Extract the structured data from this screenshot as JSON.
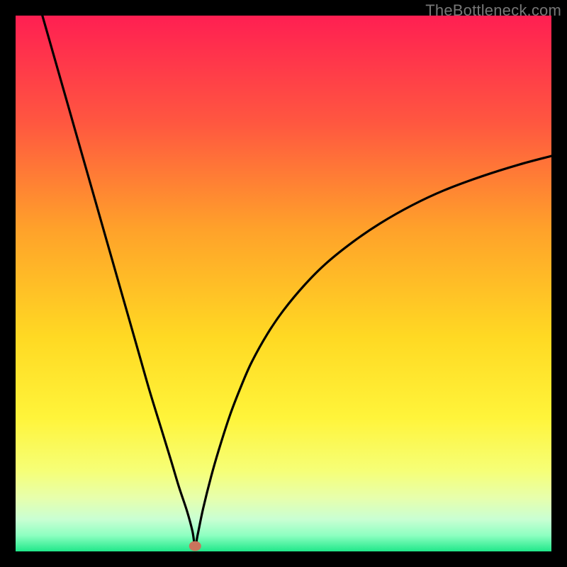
{
  "watermark": "TheBottleneck.com",
  "chart_data": {
    "type": "line",
    "title": "",
    "xlabel": "",
    "ylabel": "",
    "xlim": [
      0,
      100
    ],
    "ylim": [
      0,
      100
    ],
    "grid": false,
    "legend": false,
    "gradient_stops": [
      {
        "offset": 0.0,
        "color": "#ff1f52"
      },
      {
        "offset": 0.2,
        "color": "#ff5740"
      },
      {
        "offset": 0.4,
        "color": "#ffa22a"
      },
      {
        "offset": 0.6,
        "color": "#ffd923"
      },
      {
        "offset": 0.75,
        "color": "#fff43a"
      },
      {
        "offset": 0.85,
        "color": "#f6ff77"
      },
      {
        "offset": 0.9,
        "color": "#e7ffac"
      },
      {
        "offset": 0.94,
        "color": "#c9ffd3"
      },
      {
        "offset": 0.97,
        "color": "#8effc1"
      },
      {
        "offset": 1.0,
        "color": "#20e88a"
      }
    ],
    "marker": {
      "x": 33.5,
      "y": 1.0,
      "color": "#c9745c"
    },
    "series": [
      {
        "name": "curve",
        "color": "#000000",
        "x": [
          5,
          7,
          9,
          11,
          13,
          15,
          17,
          19,
          21,
          23,
          25,
          27,
          29,
          30.5,
          32,
          33,
          33.5,
          34,
          35,
          36.5,
          38,
          40,
          42,
          44,
          47,
          50,
          54,
          58,
          63,
          68,
          74,
          80,
          87,
          94,
          100
        ],
        "values": [
          100,
          93,
          86,
          79,
          72,
          65,
          58,
          51,
          44,
          37,
          30,
          23.5,
          17,
          12,
          7.5,
          3.8,
          1.0,
          3.2,
          8.0,
          14.0,
          19.2,
          25.4,
          30.6,
          35.2,
          40.6,
          45.0,
          49.8,
          53.8,
          57.8,
          61.2,
          64.6,
          67.4,
          70.0,
          72.2,
          73.8
        ]
      }
    ]
  }
}
